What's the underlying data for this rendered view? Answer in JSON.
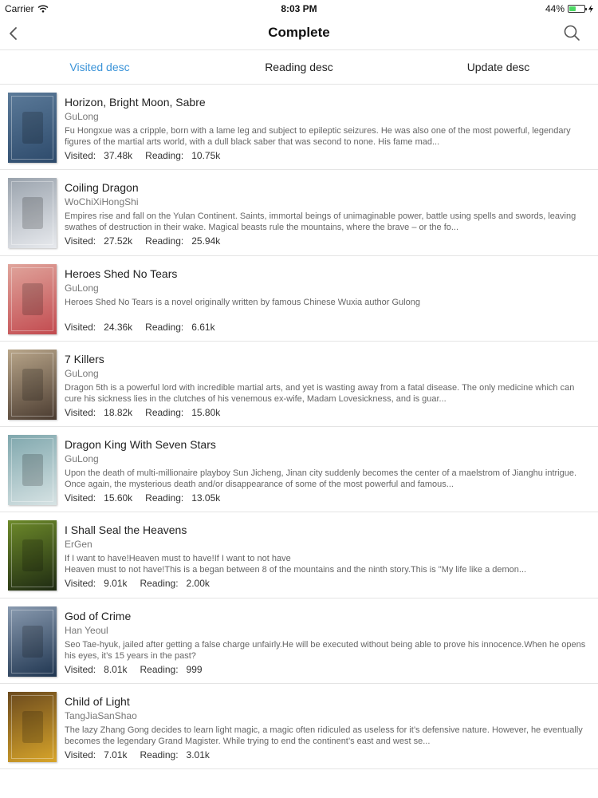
{
  "status_bar": {
    "carrier": "Carrier",
    "time": "8:03 PM",
    "battery": "44%"
  },
  "nav": {
    "title": "Complete"
  },
  "tabs": [
    {
      "label": "Visited desc",
      "active": true
    },
    {
      "label": "Reading desc",
      "active": false
    },
    {
      "label": "Update desc",
      "active": false
    }
  ],
  "stat_labels": {
    "visited": "Visited:",
    "reading": "Reading:"
  },
  "colors": {
    "accent": "#3a93d8",
    "divider": "#e4e4e4",
    "battery": "#4cd964"
  },
  "books": [
    {
      "title": "Horizon, Bright Moon, Sabre",
      "author": "GuLong",
      "description": "Fu Hongxue was a cripple, born with a lame leg and subject to epileptic seizures.  He was also one of the most powerful, legendary figures of the martial arts world, with a dull black saber that was second to none.  His fame mad...",
      "visited": "37.48k",
      "reading": "10.75k",
      "cover_colors": [
        "#2d4a6b",
        "#5b7a99"
      ]
    },
    {
      "title": "Coiling Dragon",
      "author": "WoChiXiHongShi",
      "description": "Empires rise and fall on the Yulan Continent. Saints, immortal beings of unimaginable power, battle using spells and swords, leaving swathes of destruction in their wake. Magical beasts rule the mountains, where the brave – or the fo...",
      "visited": "27.52k",
      "reading": "25.94k",
      "cover_colors": [
        "#e8eaee",
        "#9aa3ad"
      ]
    },
    {
      "title": "Heroes Shed No Tears",
      "author": "GuLong",
      "description": "Heroes Shed No Tears is a novel originally written by famous Chinese Wuxia author Gulong",
      "visited": "24.36k",
      "reading": "6.61k",
      "cover_colors": [
        "#c24a4f",
        "#e0a59c"
      ]
    },
    {
      "title": "7 Killers",
      "author": "GuLong",
      "description": "Dragon 5th is a powerful lord with incredible martial arts, and yet is wasting away from a fatal disease. The only medicine which can cure his sickness lies in the clutches of his venemous ex-wife, Madam Lovesickness, and is guar...",
      "visited": "18.82k",
      "reading": "15.80k",
      "cover_colors": [
        "#4a3b30",
        "#b9a68a"
      ]
    },
    {
      "title": "Dragon King With Seven Stars",
      "author": "GuLong",
      "description": "Upon the death of multi-millionaire playboy Sun Jicheng, Jinan city suddenly becomes the center of a maelstrom of Jianghu intrigue. Once again, the mysterious death and/or disappearance of some of the most powerful and famous...",
      "visited": "15.60k",
      "reading": "13.05k",
      "cover_colors": [
        "#d7e3e4",
        "#7fa7ad"
      ]
    },
    {
      "title": "I Shall Seal the Heavens",
      "author": "ErGen",
      "description": "If I want to have!Heaven must to have!If I want to not have\nHeaven must to not have!This is a began between 8 of the mountains and the ninth story.This is \"My life like a demon...",
      "visited": "9.01k",
      "reading": "2.00k",
      "cover_colors": [
        "#1e2a12",
        "#6d8a2a"
      ]
    },
    {
      "title": "God of Crime",
      "author": "Han Yeoul",
      "description": "Seo Tae-hyuk, jailed after getting a false charge unfairly.He will be executed without being able to prove his innocence.When he opens his eyes, it’s 15 years in the past?",
      "visited": "8.01k",
      "reading": "999",
      "cover_colors": [
        "#1f3550",
        "#8a9bb0"
      ]
    },
    {
      "title": "Child of Light",
      "author": "TangJiaSanShao",
      "description": "The lazy Zhang Gong decides to learn light magic, a magic often ridiculed as useless for it’s defensive nature. However, he eventually becomes the legendary Grand Magister. While trying to end the continent’s east and west se...",
      "visited": "7.01k",
      "reading": "3.01k",
      "cover_colors": [
        "#d8a52a",
        "#6b4a1e"
      ]
    }
  ]
}
